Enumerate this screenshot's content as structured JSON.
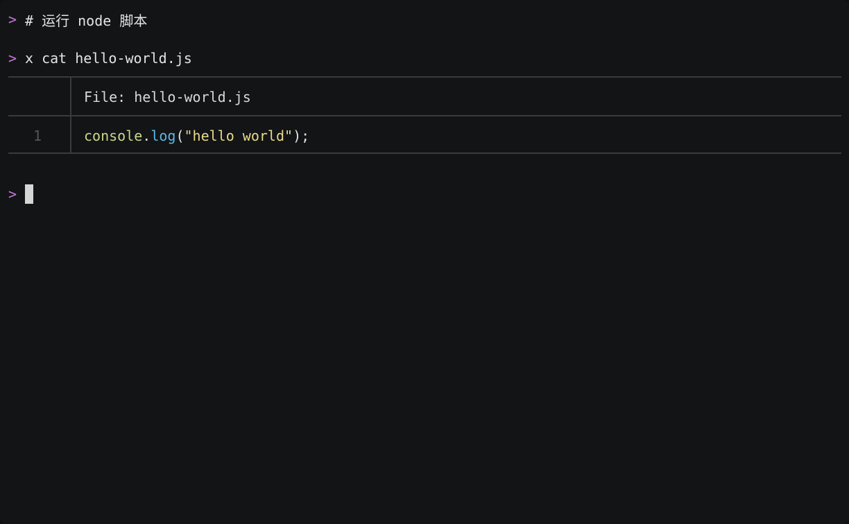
{
  "terminal": {
    "prompt_symbol": ">",
    "lines": [
      {
        "command": "# 运行 node 脚本"
      },
      {
        "command": "x cat hello-world.js"
      }
    ],
    "bat_output": {
      "header": "File: hello-world.js",
      "code_lines": [
        {
          "number": "1",
          "tokens": {
            "object": "console",
            "dot": ".",
            "method": "log",
            "open_paren": "(",
            "string": "\"hello world\"",
            "close": ");"
          }
        }
      ]
    }
  },
  "colors": {
    "background": "#131416",
    "prompt": "#c678dd",
    "text": "#e4e4e4",
    "border": "#3a3b3f",
    "line_number": "#55575b",
    "token_object": "#c8d98a",
    "token_method": "#5bb8e8",
    "token_string": "#e8d98d"
  }
}
